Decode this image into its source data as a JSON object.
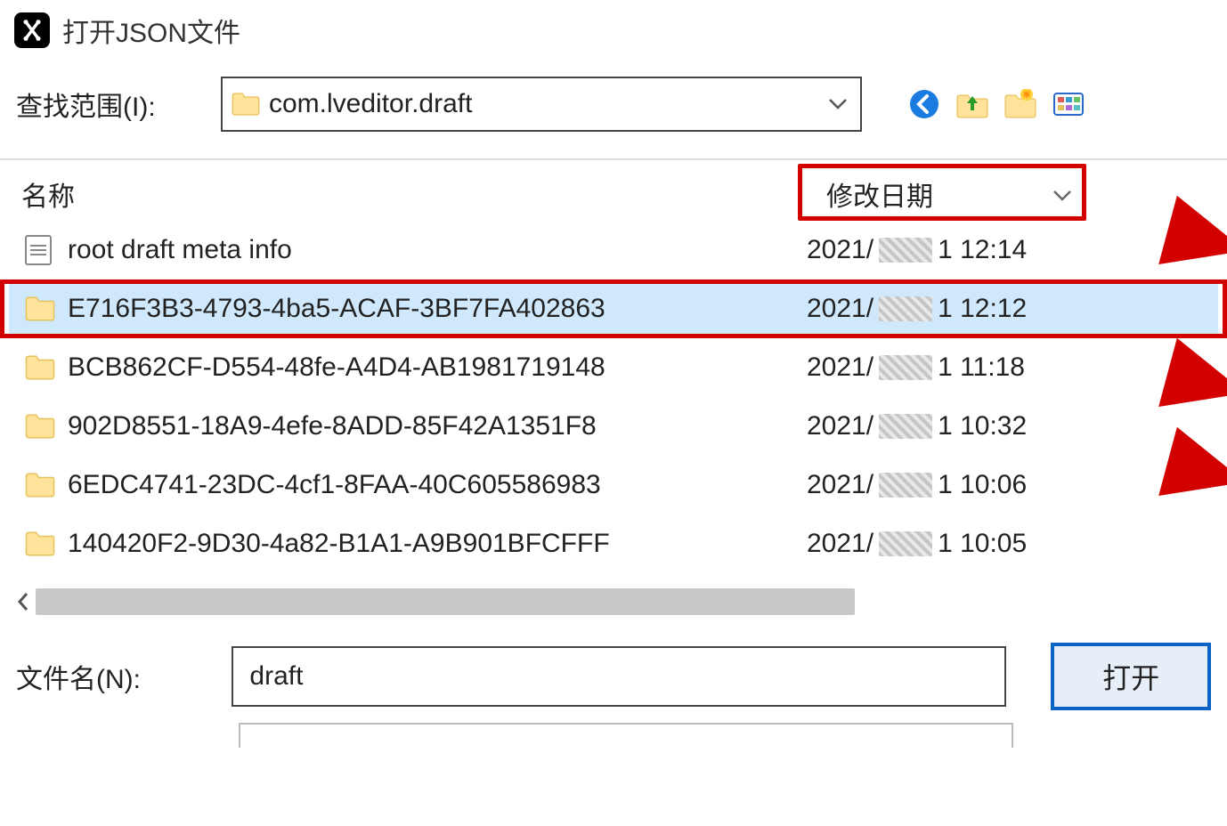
{
  "window": {
    "title": "打开JSON文件"
  },
  "lookup": {
    "label": "查找范围(I):",
    "path": "com.lveditor.draft"
  },
  "columns": {
    "name": "名称",
    "date": "修改日期"
  },
  "files": [
    {
      "icon": "doc",
      "name": "root_draft_meta_info",
      "date_prefix": "2021/",
      "date_suffix": "1 12:14",
      "selected": false,
      "highlight": false
    },
    {
      "icon": "folder",
      "name": "E716F3B3-4793-4ba5-ACAF-3BF7FA402863",
      "date_prefix": "2021/",
      "date_suffix": "1 12:12",
      "selected": true,
      "highlight": true
    },
    {
      "icon": "folder",
      "name": "BCB862CF-D554-48fe-A4D4-AB1981719148",
      "date_prefix": "2021/",
      "date_suffix": "1 11:18",
      "selected": false,
      "highlight": false
    },
    {
      "icon": "folder",
      "name": "902D8551-18A9-4efe-8ADD-85F42A1351F8",
      "date_prefix": "2021/",
      "date_suffix": "1 10:32",
      "selected": false,
      "highlight": false
    },
    {
      "icon": "folder",
      "name": "6EDC4741-23DC-4cf1-8FAA-40C605586983",
      "date_prefix": "2021/",
      "date_suffix": "1 10:06",
      "selected": false,
      "highlight": false
    },
    {
      "icon": "folder",
      "name": "140420F2-9D30-4a82-B1A1-A9B901BFCFFF",
      "date_prefix": "2021/",
      "date_suffix": "1 10:05",
      "selected": false,
      "highlight": false
    }
  ],
  "filename": {
    "label": "文件名(N):",
    "value": "draft"
  },
  "buttons": {
    "open": "打开"
  }
}
